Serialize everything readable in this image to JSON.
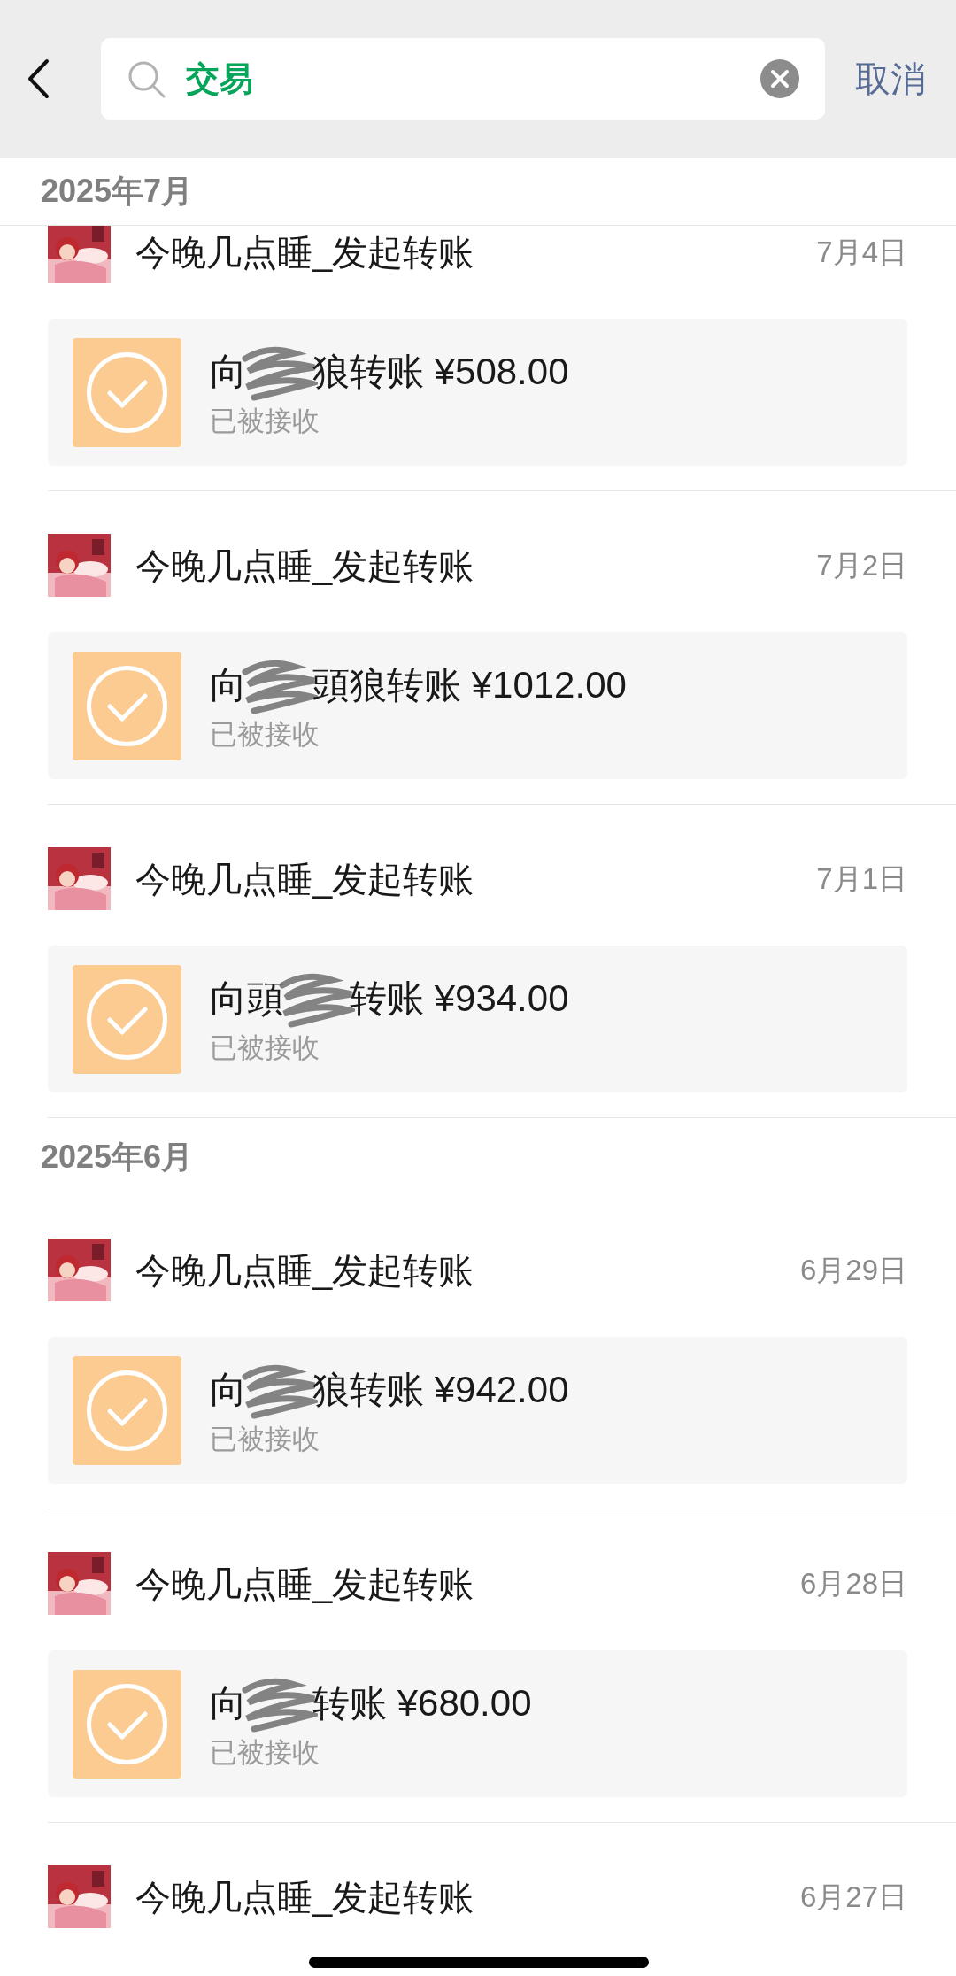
{
  "search": {
    "value": "交易",
    "cancel": "取消"
  },
  "sections": [
    {
      "title": "2025年7月",
      "items": [
        {
          "sender": "今晚几点睡_发起转账",
          "date": "7月4日",
          "before": "向",
          "after": "狼转账 ¥508.00",
          "status": "已被接收"
        },
        {
          "sender": "今晚几点睡_发起转账",
          "date": "7月2日",
          "before": "向",
          "after": "頭狼转账 ¥1012.00",
          "status": "已被接收"
        },
        {
          "sender": "今晚几点睡_发起转账",
          "date": "7月1日",
          "before": "向頭",
          "after": "转账 ¥934.00",
          "status": "已被接收"
        }
      ]
    },
    {
      "title": "2025年6月",
      "items": [
        {
          "sender": "今晚几点睡_发起转账",
          "date": "6月29日",
          "before": "向",
          "after": "狼转账 ¥942.00",
          "status": "已被接收"
        },
        {
          "sender": "今晚几点睡_发起转账",
          "date": "6月28日",
          "before": "向",
          "after": "转账 ¥680.00",
          "status": "已被接收"
        },
        {
          "sender": "今晚几点睡_发起转账",
          "date": "6月27日"
        }
      ]
    }
  ]
}
